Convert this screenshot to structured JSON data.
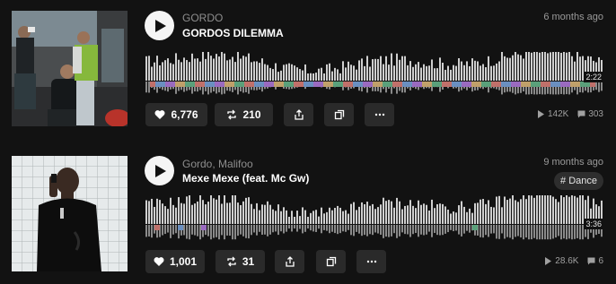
{
  "tracks": [
    {
      "artist": "GORDO",
      "title": "GORDOS DILEMMA",
      "posted": "6 months ago",
      "duration": "2:22",
      "likes": "6,776",
      "reposts": "210",
      "plays": "142K",
      "comments": "303",
      "artwork_icon": "photo-group-street-icon"
    },
    {
      "artist": "Gordo, Malifoo",
      "title": "Mexe Mexe (feat. Mc Gw)",
      "posted": "9 months ago",
      "tag": "# Dance",
      "duration": "3:36",
      "likes": "1,001",
      "reposts": "31",
      "plays": "28.6K",
      "comments": "6",
      "artwork_icon": "photo-man-phone-tiles-icon"
    }
  ],
  "colors": {
    "background": "#121212",
    "button_bg": "#2a2a2a",
    "waveform": "#cfcfcf",
    "muted_text": "#8e8e8e"
  }
}
